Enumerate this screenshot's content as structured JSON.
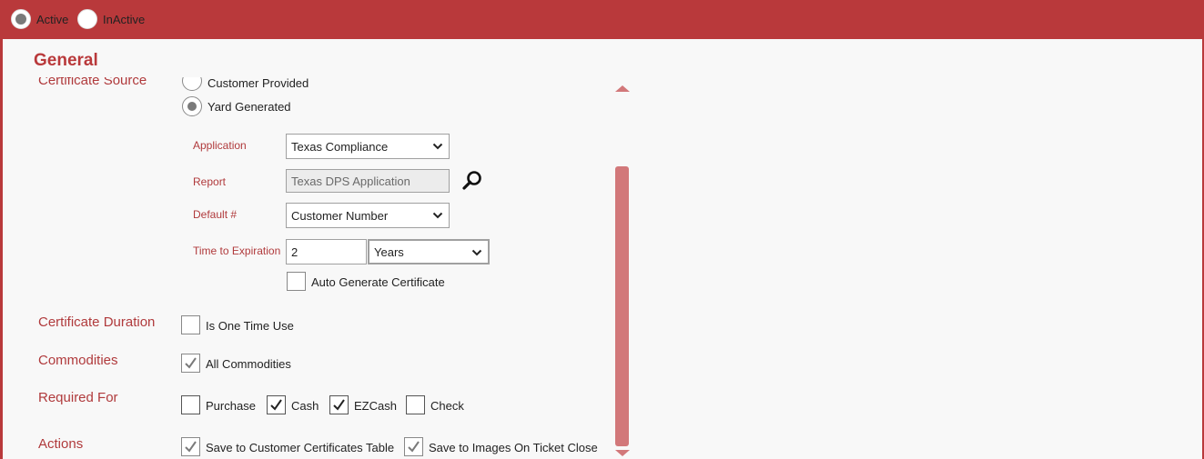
{
  "status": {
    "active_label": "Active",
    "inactive_label": "InActive",
    "selected": "active"
  },
  "section": {
    "title": "General"
  },
  "certificate_source": {
    "label": "Certificate Source",
    "options": [
      {
        "label": "Customer Provided",
        "checked": false
      },
      {
        "label": "Yard Generated",
        "checked": true
      }
    ]
  },
  "application": {
    "label": "Application",
    "value": "Texas Compliance"
  },
  "report": {
    "label": "Report",
    "value": "Texas DPS Application"
  },
  "default_number": {
    "label": "Default #",
    "value": "Customer Number"
  },
  "expiration": {
    "label": "Time to Expiration",
    "value": "2",
    "unit": "Years"
  },
  "auto_generate": {
    "label": "Auto Generate Certificate",
    "checked": false
  },
  "duration": {
    "label": "Certificate Duration",
    "one_time_label": "Is One Time Use",
    "checked": false
  },
  "commodities": {
    "label": "Commodities",
    "all_label": "All Commodities",
    "checked": true
  },
  "required_for": {
    "label": "Required For",
    "options": [
      {
        "label": "Purchase",
        "checked": false
      },
      {
        "label": "Cash",
        "checked": true
      },
      {
        "label": "EZCash",
        "checked": true
      },
      {
        "label": "Check",
        "checked": false
      }
    ]
  },
  "actions": {
    "label": "Actions",
    "options": [
      {
        "label": "Save to Customer Certificates Table",
        "checked": true
      },
      {
        "label": "Save to Images On Ticket Close",
        "checked": true
      }
    ]
  },
  "colors": {
    "accent": "#b9393b",
    "label": "#b03a3c",
    "scrollbar": "#d2787a",
    "panel": "#f8f8f8"
  }
}
